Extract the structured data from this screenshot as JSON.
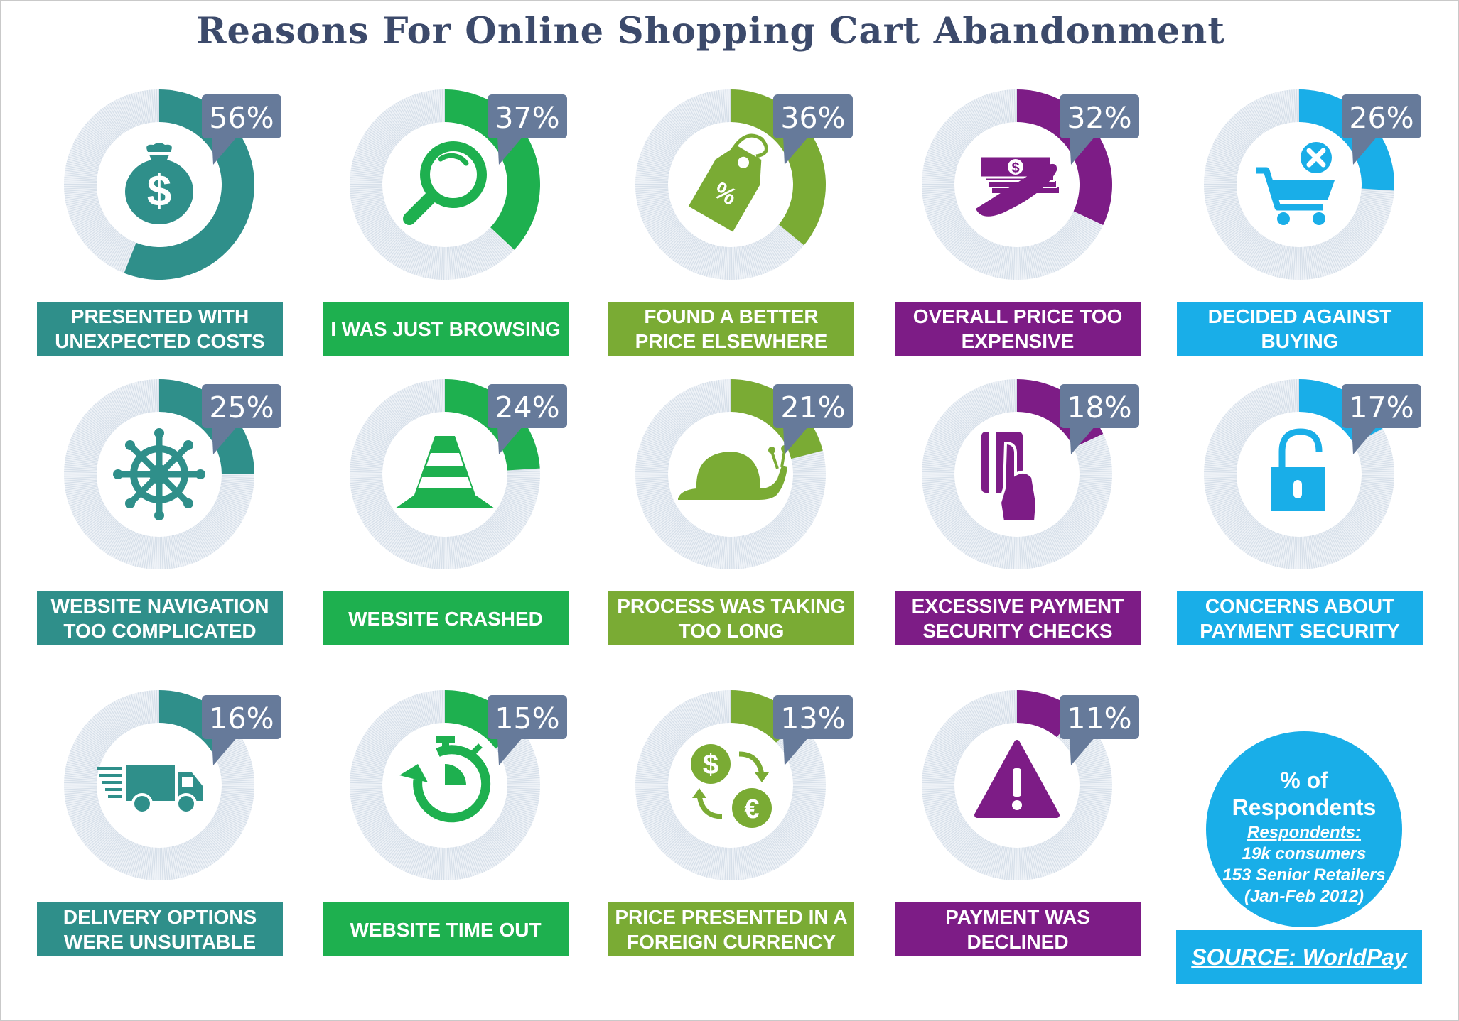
{
  "chart_data": {
    "type": "donut",
    "title": "Reasons For Online Shopping Cart Abandonment",
    "unit": "%",
    "ylim": [
      0,
      100
    ],
    "items": [
      {
        "label": "PRESENTED WITH UNEXPECTED COSTS",
        "value": 56,
        "display": "56%",
        "color": "#2f8f8a",
        "icon": "money-bag-icon"
      },
      {
        "label": "I WAS JUST BROWSING",
        "value": 37,
        "display": "37%",
        "color": "#1eb04f",
        "icon": "magnifier-icon"
      },
      {
        "label": "FOUND A BETTER PRICE ELSEWHERE",
        "value": 36,
        "display": "36%",
        "color": "#7aab34",
        "icon": "price-tag-icon"
      },
      {
        "label": "OVERALL PRICE TOO EXPENSIVE",
        "value": 32,
        "display": "32%",
        "color": "#7d1c86",
        "icon": "cash-stack-icon"
      },
      {
        "label": "DECIDED AGAINST BUYING",
        "value": 26,
        "display": "26%",
        "color": "#19aee8",
        "icon": "cart-cancel-icon"
      },
      {
        "label": "WEBSITE NAVIGATION TOO COMPLICATED",
        "value": 25,
        "display": "25%",
        "color": "#2f8f8a",
        "icon": "ship-wheel-icon"
      },
      {
        "label": "WEBSITE CRASHED",
        "value": 24,
        "display": "24%",
        "color": "#1eb04f",
        "icon": "traffic-cone-icon"
      },
      {
        "label": "PROCESS WAS TAKING TOO LONG",
        "value": 21,
        "display": "21%",
        "color": "#7aab34",
        "icon": "snail-icon"
      },
      {
        "label": "EXCESSIVE PAYMENT SECURITY CHECKS",
        "value": 18,
        "display": "18%",
        "color": "#7d1c86",
        "icon": "card-in-hand-icon"
      },
      {
        "label": "CONCERNS ABOUT PAYMENT SECURITY",
        "value": 17,
        "display": "17%",
        "color": "#19aee8",
        "icon": "padlock-icon"
      },
      {
        "label": "DELIVERY OPTIONS WERE UNSUITABLE",
        "value": 16,
        "display": "16%",
        "color": "#2f8f8a",
        "icon": "delivery-van-icon"
      },
      {
        "label": "WEBSITE TIME OUT",
        "value": 15,
        "display": "15%",
        "color": "#1eb04f",
        "icon": "stopwatch-icon"
      },
      {
        "label": "PRICE PRESENTED IN A FOREIGN CURRENCY",
        "value": 13,
        "display": "13%",
        "color": "#7aab34",
        "icon": "currency-exchange-icon"
      },
      {
        "label": "PAYMENT WAS DECLINED",
        "value": 11,
        "display": "11%",
        "color": "#7d1c86",
        "icon": "warning-icon"
      }
    ],
    "callout_color": "#667a9a"
  },
  "summary": {
    "pct_of": "% of Respondents",
    "respondents_heading": "Respondents:",
    "respondents_lines": [
      "19k consumers",
      "153 Senior Retailers",
      "(Jan-Feb 2012)"
    ],
    "source": "SOURCE: WorldPay"
  }
}
